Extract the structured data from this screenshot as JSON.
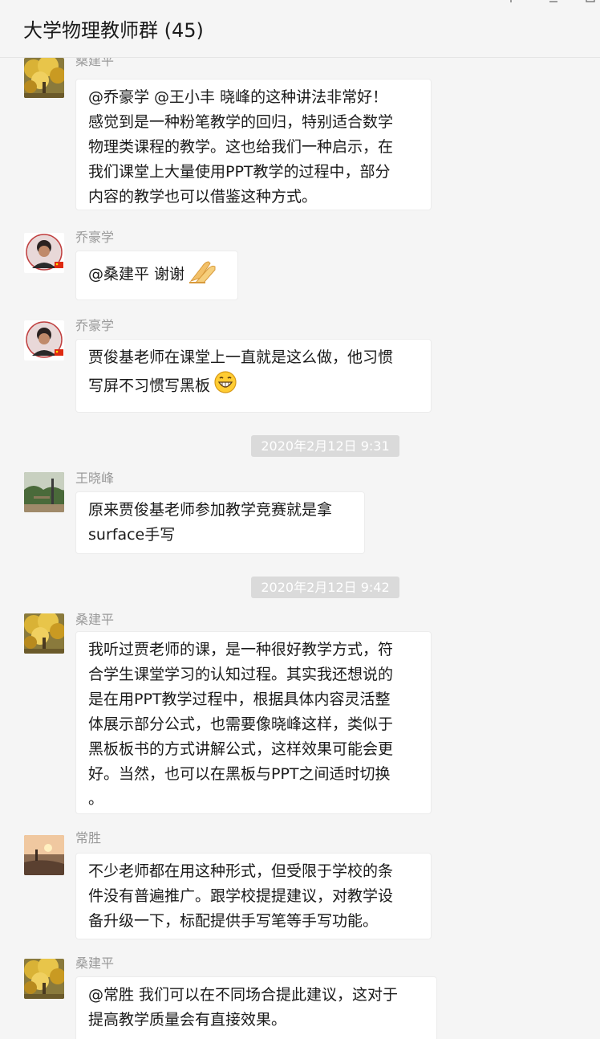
{
  "window": {
    "title": "大学物理教师群 (45)",
    "pin_icon": "pin-icon",
    "minimize_icon": "minimize-icon",
    "maximize_icon": "maximize-icon"
  },
  "messages": [
    {
      "sender": "桑建平",
      "avatar": "ginkgo-tree-avatar",
      "lines": [
        "@乔豪学 @王小丰 晓峰的这种讲法非常好！",
        "感觉到是一种粉笔教学的回归，特别适合数学",
        "物理类课程的教学。这也给我们一种启示，在",
        "我们课堂上大量使用PPT教学的过程中，部分",
        "内容的教学也可以借鉴这种方式。"
      ]
    },
    {
      "sender": "乔豪学",
      "avatar": "portrait-flag-avatar",
      "lines": [
        "@桑建平 谢谢"
      ],
      "emoji": "praying-hands-emoji"
    },
    {
      "sender": "乔豪学",
      "avatar": "portrait-flag-avatar",
      "lines": [
        "贾俊基老师在课堂上一直就是这么做，他习惯",
        "写屏不习惯写黑板"
      ],
      "emoji": "grin-emoji"
    },
    {
      "timestamp": "2020年2月12日 9:31"
    },
    {
      "sender": "王晓峰",
      "avatar": "landscape-avatar",
      "lines": [
        "原来贾俊基老师参加教学竞赛就是拿",
        "surface手写"
      ]
    },
    {
      "timestamp": "2020年2月12日 9:42"
    },
    {
      "sender": "桑建平",
      "avatar": "ginkgo-tree-avatar",
      "lines": [
        "我听过贾老师的课，是一种很好教学方式，符",
        "合学生课堂学习的认知过程。其实我还想说的",
        "是在用PPT教学过程中，根据具体内容灵活整",
        "体展示部分公式，也需要像晓峰这样，类似于",
        "黑板板书的方式讲解公式，这样效果可能会更",
        "好。当然，也可以在黑板与PPT之间适时切换",
        "。"
      ]
    },
    {
      "sender": "常胜",
      "avatar": "sunset-lake-avatar",
      "lines": [
        "不少老师都在用这种形式，但受限于学校的条",
        "件没有普遍推广。跟学校提提建议，对教学设",
        "备升级一下，标配提供手写笔等手写功能。"
      ]
    },
    {
      "sender": "桑建平",
      "avatar": "ginkgo-tree-avatar",
      "lines": [
        "@常胜 我们可以在不同场合提此建议，这对于",
        "提高教学质量会有直接效果。"
      ]
    }
  ]
}
